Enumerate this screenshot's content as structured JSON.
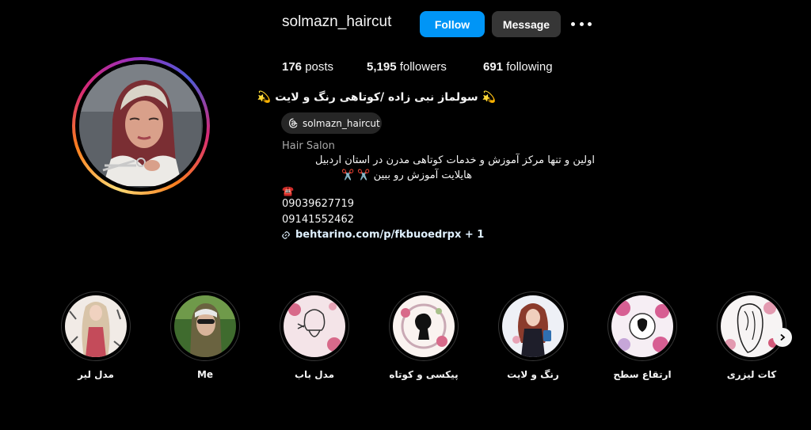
{
  "profile": {
    "username": "solmazn_haircut",
    "follow_label": "Follow",
    "message_label": "Message",
    "more_icon": "more-options-icon",
    "ring_colors": [
      "#feda75",
      "#fa7e1e",
      "#d62976",
      "#962fbf",
      "#4f5bd5"
    ]
  },
  "stats": {
    "posts_count": "176",
    "posts_label": "posts",
    "followers_count": "5,195",
    "followers_label": "followers",
    "following_count": "691",
    "following_label": "following"
  },
  "bio": {
    "full_name": "💫 سولماز نبی زاده /کوتاهی رنگ و لایت 💫",
    "threads_handle": "solmazn_haircut",
    "category": "Hair Salon",
    "line1": "اولین و تنها مرکز آموزش و خدمات کوتاهی مدرن در استان اردبیل",
    "line2": "هایلایت آموزش رو ببین ✂️ ✂️",
    "line3": "☎️",
    "phone1": "09039627719",
    "phone2": "09141552462",
    "link_text": "behtarino.com/p/fkbuoedrpx + 1"
  },
  "highlights": [
    {
      "label": "مدل لیر"
    },
    {
      "label": "Me"
    },
    {
      "label": "مدل باب"
    },
    {
      "label": "پیکسی و کوتاه"
    },
    {
      "label": "رنگ و لایت"
    },
    {
      "label": "ارتقاع سطح"
    },
    {
      "label": "کات لیزری"
    }
  ],
  "colors": {
    "follow_button": "#0095f6",
    "secondary_button": "#363636",
    "background": "#000000"
  }
}
